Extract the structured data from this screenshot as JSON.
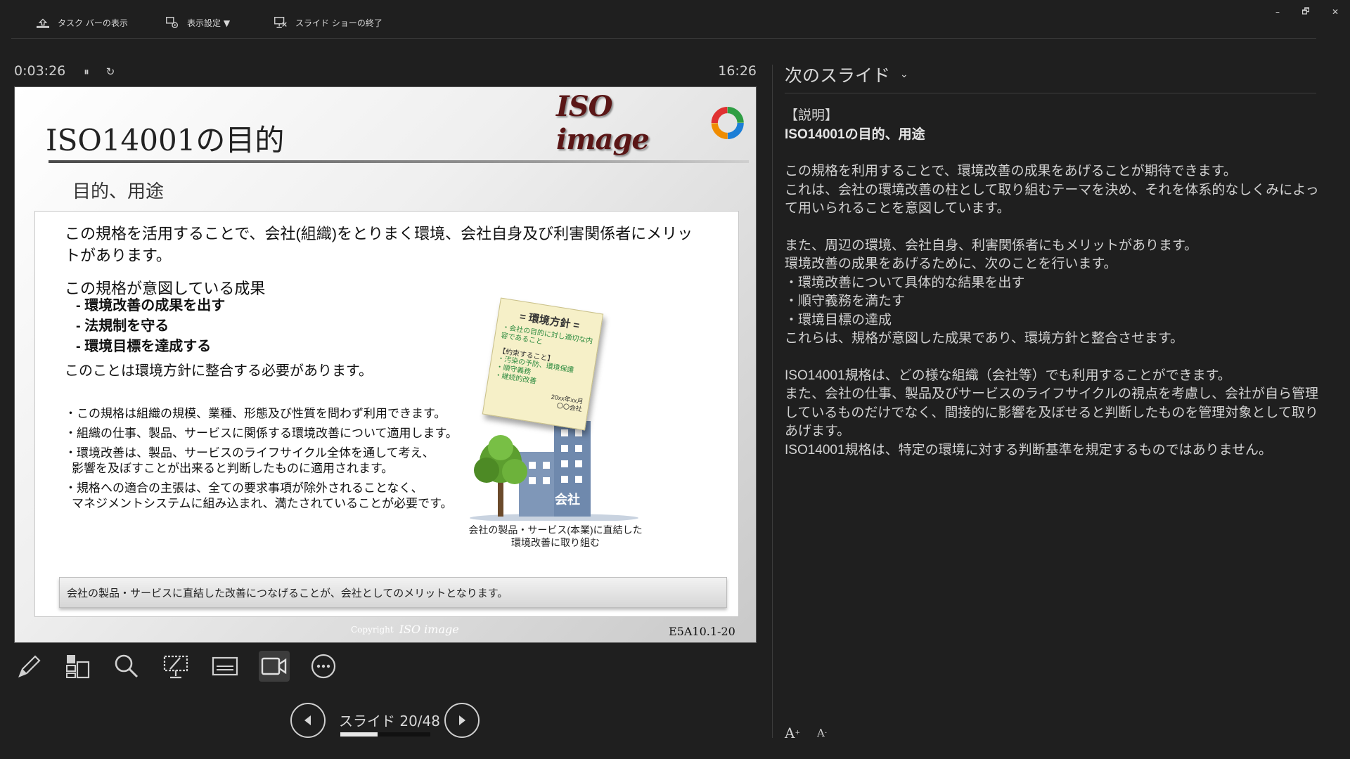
{
  "toolbar": {
    "taskbar_label": "タスク バーの表示",
    "display_settings_label": "表示設定 ▼",
    "end_show_label": "スライド ショーの終了"
  },
  "window": {
    "minimize": "–",
    "restore": "🗗",
    "close": "✕"
  },
  "presenter": {
    "elapsed": "0:03:26",
    "pause_glyph": "⏸",
    "restart_glyph": "↻",
    "clock": "16:26",
    "slide_counter": "スライド 20/48",
    "current_slide": 20,
    "total_slides": 48
  },
  "slide": {
    "title": "ISO14001の目的",
    "subtitle": "目的、用途",
    "logo_text": "ISO image",
    "lead": "この規格を活用することで、会社(組織)をとりまく環境、会社自身及び利害関係者にメリットがあります。",
    "outcomes_heading": "この規格が意図している成果",
    "outcomes": [
      "- 環境改善の成果を出す",
      "- 法規制を守る",
      "- 環境目標を達成する"
    ],
    "policy_line": "このことは環境方針に整合する必要があります。",
    "bullets": [
      "・この規格は組織の規模、業種、形態及び性質を問わず利用できます。",
      "・組織の仕事、製品、サービスに関係する環境改善について適用します。",
      "・環境改善は、製品、サービスのライフサイクル全体を通して考え、",
      "影響を及ぼすことが出来ると判断したものに適用されます。",
      "・規格への適合の主張は、全ての要求事項が除外されることなく、",
      "マネジメントシステムに組み込まれ、満たされていることが必要です。"
    ],
    "note": {
      "title": "= 環境方針 =",
      "sub": "・会社の目的に対し適切な内容であること",
      "label": "【約束すること】",
      "items": [
        "・汚染の予防、環境保護",
        "・順守義務",
        "・継続的改善"
      ],
      "date": "20xx年xx月",
      "company": "〇〇会社"
    },
    "building_label": "会社",
    "illustration_caption": "会社の製品・サービス(本業)に直結した環境改善に取り組む",
    "banner": "会社の製品・サービスに直結した改善につなげることが、会社としてのメリットとなります。",
    "copyright_label": "Copyright",
    "copyright_logo": "ISO image",
    "slide_id": "E5A10.1-20"
  },
  "tools": [
    "pen-tool",
    "slide-sorter",
    "zoom",
    "pointer",
    "subtitles",
    "camera",
    "more-options"
  ],
  "notes_panel": {
    "header": "次のスライド",
    "chevron": "⌄",
    "lines": [
      {
        "text": "【説明】",
        "bold": false
      },
      {
        "text": "ISO14001の目的、用途",
        "bold": true
      },
      {
        "text": "",
        "bold": false
      },
      {
        "text": "この規格を利用することで、環境改善の成果をあげることが期待できます。",
        "bold": false
      },
      {
        "text": "これは、会社の環境改善の柱として取り組むテーマを決め、それを体系的なしくみによって用いられることを意図しています。",
        "bold": false
      },
      {
        "text": "",
        "bold": false
      },
      {
        "text": "また、周辺の環境、会社自身、利害関係者にもメリットがあります。",
        "bold": false
      },
      {
        "text": "環境改善の成果をあげるために、次のことを行います。",
        "bold": false
      },
      {
        "text": "・環境改善について具体的な結果を出す",
        "bold": false
      },
      {
        "text": "・順守義務を満たす",
        "bold": false
      },
      {
        "text": "・環境目標の達成",
        "bold": false
      },
      {
        "text": "これらは、規格が意図した成果であり、環境方針と整合させます。",
        "bold": false
      },
      {
        "text": "",
        "bold": false
      },
      {
        "text": "ISO14001規格は、どの様な組織（会社等）でも利用することができます。",
        "bold": false
      },
      {
        "text": "また、会社の仕事、製品及びサービスのライフサイクルの視点を考慮し、会社が自ら管理しているものだけでなく、間接的に影響を及ぼせると判断したものを管理対象として取りあげます。",
        "bold": false
      },
      {
        "text": "ISO14001規格は、特定の環境に対する判断基準を規定するものではありません。",
        "bold": false
      }
    ],
    "font_increase": "A",
    "font_decrease": "A"
  }
}
